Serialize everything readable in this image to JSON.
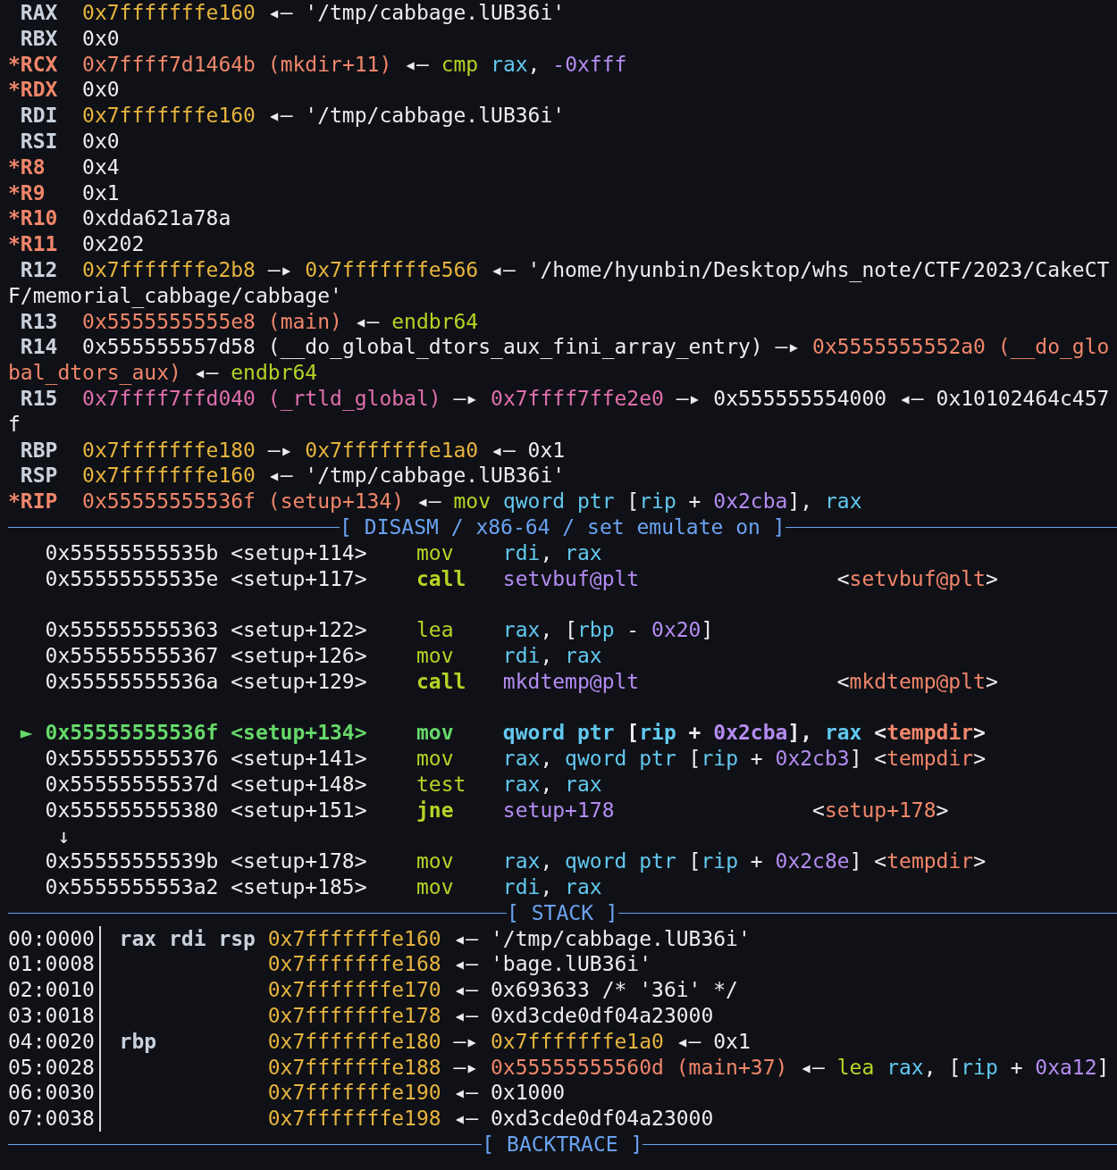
{
  "registers": [
    {
      "name": "RAX",
      "changed": false,
      "value": [
        {
          "text": "0x7fffffffe160",
          "kind": "stack"
        },
        {
          "text": "◂—",
          "kind": "arrow"
        },
        {
          "text": "'/tmp/cabbage.lUB36i'",
          "kind": "str"
        }
      ]
    },
    {
      "name": "RBX",
      "changed": false,
      "value": [
        {
          "text": "0x0",
          "kind": "plain"
        }
      ]
    },
    {
      "name": "*RCX",
      "changed": true,
      "value": [
        {
          "text": "0x7ffff7d1464b",
          "kind": "code"
        },
        {
          "text": "(mkdir+11)",
          "kind": "code"
        },
        {
          "text": "◂—",
          "kind": "arrow"
        },
        {
          "text": "cmp",
          "kind": "mnem"
        },
        {
          "text": "rax",
          "kind": "reg"
        },
        {
          "text": ",",
          "kind": "close"
        },
        {
          "text": "-0xfff",
          "kind": "num"
        }
      ]
    },
    {
      "name": "*RDX",
      "changed": true,
      "value": [
        {
          "text": "0x0",
          "kind": "plain"
        }
      ]
    },
    {
      "name": "RDI",
      "changed": false,
      "value": [
        {
          "text": "0x7fffffffe160",
          "kind": "stack"
        },
        {
          "text": "◂—",
          "kind": "arrow"
        },
        {
          "text": "'/tmp/cabbage.lUB36i'",
          "kind": "str"
        }
      ]
    },
    {
      "name": "RSI",
      "changed": false,
      "value": [
        {
          "text": "0x0",
          "kind": "plain"
        }
      ]
    },
    {
      "name": "*R8",
      "changed": true,
      "value": [
        {
          "text": "0x4",
          "kind": "plain"
        }
      ]
    },
    {
      "name": "*R9",
      "changed": true,
      "value": [
        {
          "text": "0x1",
          "kind": "plain"
        }
      ]
    },
    {
      "name": "*R10",
      "changed": true,
      "value": [
        {
          "text": "0xdda621a78a",
          "kind": "plain"
        }
      ]
    },
    {
      "name": "*R11",
      "changed": true,
      "value": [
        {
          "text": "0x202",
          "kind": "plain"
        }
      ]
    },
    {
      "name": "R12",
      "changed": false,
      "value": [
        {
          "text": "0x7fffffffe2b8",
          "kind": "stack"
        },
        {
          "text": "—▸",
          "kind": "arrow"
        },
        {
          "text": "0x7fffffffe566",
          "kind": "stack"
        },
        {
          "text": "◂—",
          "kind": "arrow"
        },
        {
          "text": "'/home/hyunbin/Desktop/whs_note/CTF/2023/CakeCT",
          "kind": "str"
        }
      ],
      "wrap": [
        {
          "text": "F/memorial_cabbage/cabbage'",
          "kind": "str"
        }
      ]
    },
    {
      "name": "R13",
      "changed": false,
      "value": [
        {
          "text": "0x5555555555e8",
          "kind": "code"
        },
        {
          "text": "(main)",
          "kind": "code"
        },
        {
          "text": "◂—",
          "kind": "arrow"
        },
        {
          "text": "endbr64",
          "kind": "mnem"
        }
      ]
    },
    {
      "name": "R14",
      "changed": false,
      "value": [
        {
          "text": "0x555555557d58",
          "kind": "plain"
        },
        {
          "text": "(__do_global_dtors_aux_fini_array_entry)",
          "kind": "plain"
        },
        {
          "text": "—▸",
          "kind": "arrow"
        },
        {
          "text": "0x5555555552a0",
          "kind": "code"
        },
        {
          "text": "(__do_glo",
          "kind": "code"
        }
      ],
      "wrap": [
        {
          "text": "bal_dtors_aux)",
          "kind": "code"
        },
        {
          "text": "◂—",
          "kind": "arrow"
        },
        {
          "text": "endbr64",
          "kind": "mnem"
        }
      ]
    },
    {
      "name": "R15",
      "changed": false,
      "value": [
        {
          "text": "0x7ffff7ffd040",
          "kind": "data"
        },
        {
          "text": "(_rtld_global)",
          "kind": "data"
        },
        {
          "text": "—▸",
          "kind": "arrow"
        },
        {
          "text": "0x7ffff7ffe2e0",
          "kind": "data"
        },
        {
          "text": "—▸",
          "kind": "arrow"
        },
        {
          "text": "0x555555554000",
          "kind": "plain"
        },
        {
          "text": "◂—",
          "kind": "arrow"
        },
        {
          "text": "0x10102464c457",
          "kind": "plain"
        }
      ],
      "wrap": [
        {
          "text": "f",
          "kind": "plain"
        }
      ]
    },
    {
      "name": "RBP",
      "changed": false,
      "value": [
        {
          "text": "0x7fffffffe180",
          "kind": "stack"
        },
        {
          "text": "—▸",
          "kind": "arrow"
        },
        {
          "text": "0x7fffffffe1a0",
          "kind": "stack"
        },
        {
          "text": "◂—",
          "kind": "arrow"
        },
        {
          "text": "0x1",
          "kind": "plain"
        }
      ]
    },
    {
      "name": "RSP",
      "changed": false,
      "value": [
        {
          "text": "0x7fffffffe160",
          "kind": "stack"
        },
        {
          "text": "◂—",
          "kind": "arrow"
        },
        {
          "text": "'/tmp/cabbage.lUB36i'",
          "kind": "str"
        }
      ]
    },
    {
      "name": "*RIP",
      "changed": true,
      "value": [
        {
          "text": "0x55555555536f",
          "kind": "code"
        },
        {
          "text": "(setup+134)",
          "kind": "code"
        },
        {
          "text": "◂—",
          "kind": "arrow"
        },
        {
          "text": "mov",
          "kind": "mnem"
        },
        {
          "text": "qword ptr",
          "kind": "reg"
        },
        {
          "text": "[",
          "kind": "open"
        },
        {
          "text": "rip",
          "kind": "reg"
        },
        {
          "text": "+",
          "kind": "plain"
        },
        {
          "text": "0x2cba",
          "kind": "num"
        },
        {
          "text": "],",
          "kind": "close"
        },
        {
          "text": "rax",
          "kind": "reg"
        }
      ]
    }
  ],
  "disasm": {
    "banner": "[ DISASM / x86-64 / set emulate on ]",
    "rows": [
      {
        "kind": "insn",
        "current": false,
        "addr": "0x55555555535b",
        "sym": "<setup+114>",
        "mnemonic": "mov",
        "operands": [
          {
            "text": "rdi",
            "kind": "reg"
          },
          {
            "text": ",",
            "kind": "close"
          },
          {
            "text": "rax",
            "kind": "reg"
          }
        ]
      },
      {
        "kind": "call",
        "current": false,
        "addr": "0x55555555535e",
        "sym": "<setup+117>",
        "mnemonic": "call",
        "operands": [
          {
            "text": "setvbuf@plt",
            "kind": "target"
          }
        ],
        "comment": [
          {
            "text": "<",
            "kind": "open"
          },
          {
            "text": "setvbuf@plt",
            "kind": "code"
          },
          {
            "text": ">",
            "kind": "close"
          }
        ]
      },
      {
        "kind": "blank"
      },
      {
        "kind": "insn",
        "current": false,
        "addr": "0x555555555363",
        "sym": "<setup+122>",
        "mnemonic": "lea",
        "operands": [
          {
            "text": "rax",
            "kind": "reg"
          },
          {
            "text": ",",
            "kind": "close"
          },
          {
            "text": "[",
            "kind": "open"
          },
          {
            "text": "rbp",
            "kind": "reg"
          },
          {
            "text": "-",
            "kind": "plain"
          },
          {
            "text": "0x20",
            "kind": "num"
          },
          {
            "text": "]",
            "kind": "close"
          }
        ]
      },
      {
        "kind": "insn",
        "current": false,
        "addr": "0x555555555367",
        "sym": "<setup+126>",
        "mnemonic": "mov",
        "operands": [
          {
            "text": "rdi",
            "kind": "reg"
          },
          {
            "text": ",",
            "kind": "close"
          },
          {
            "text": "rax",
            "kind": "reg"
          }
        ]
      },
      {
        "kind": "call",
        "current": false,
        "addr": "0x55555555536a",
        "sym": "<setup+129>",
        "mnemonic": "call",
        "operands": [
          {
            "text": "mkdtemp@plt",
            "kind": "target"
          }
        ],
        "comment": [
          {
            "text": "<",
            "kind": "open"
          },
          {
            "text": "mkdtemp@plt",
            "kind": "code"
          },
          {
            "text": ">",
            "kind": "close"
          }
        ]
      },
      {
        "kind": "blank"
      },
      {
        "kind": "insn",
        "current": true,
        "marker": "►",
        "addr": "0x55555555536f",
        "sym": "<setup+134>",
        "mnemonic": "mov",
        "operands": [
          {
            "text": "qword ptr",
            "kind": "reg"
          },
          {
            "text": "[",
            "kind": "open"
          },
          {
            "text": "rip",
            "kind": "reg"
          },
          {
            "text": "+",
            "kind": "plain"
          },
          {
            "text": "0x2cba",
            "kind": "num"
          },
          {
            "text": "],",
            "kind": "close"
          },
          {
            "text": "rax",
            "kind": "reg"
          }
        ],
        "comment": [
          {
            "text": "<",
            "kind": "open"
          },
          {
            "text": "tempdir",
            "kind": "code"
          },
          {
            "text": ">",
            "kind": "close"
          }
        ]
      },
      {
        "kind": "insn",
        "current": false,
        "addr": "0x555555555376",
        "sym": "<setup+141>",
        "mnemonic": "mov",
        "operands": [
          {
            "text": "rax",
            "kind": "reg"
          },
          {
            "text": ",",
            "kind": "close"
          },
          {
            "text": "qword ptr",
            "kind": "reg"
          },
          {
            "text": "[",
            "kind": "open"
          },
          {
            "text": "rip",
            "kind": "reg"
          },
          {
            "text": "+",
            "kind": "plain"
          },
          {
            "text": "0x2cb3",
            "kind": "num"
          },
          {
            "text": "]",
            "kind": "close"
          }
        ],
        "comment": [
          {
            "text": "<",
            "kind": "open"
          },
          {
            "text": "tempdir",
            "kind": "code"
          },
          {
            "text": ">",
            "kind": "close"
          }
        ]
      },
      {
        "kind": "insn",
        "current": false,
        "addr": "0x55555555537d",
        "sym": "<setup+148>",
        "mnemonic": "test",
        "operands": [
          {
            "text": "rax",
            "kind": "reg"
          },
          {
            "text": ",",
            "kind": "close"
          },
          {
            "text": "rax",
            "kind": "reg"
          }
        ]
      },
      {
        "kind": "jump",
        "current": false,
        "addr": "0x555555555380",
        "sym": "<setup+151>",
        "mnemonic": "jne",
        "operands": [
          {
            "text": "setup+178",
            "kind": "target"
          }
        ],
        "comment": [
          {
            "text": "<",
            "kind": "open"
          },
          {
            "text": "setup+178",
            "kind": "code"
          },
          {
            "text": ">",
            "kind": "close"
          }
        ]
      },
      {
        "kind": "flow",
        "text": "↓"
      },
      {
        "kind": "insn",
        "current": false,
        "addr": "0x55555555539b",
        "sym": "<setup+178>",
        "mnemonic": "mov",
        "operands": [
          {
            "text": "rax",
            "kind": "reg"
          },
          {
            "text": ",",
            "kind": "close"
          },
          {
            "text": "qword ptr",
            "kind": "reg"
          },
          {
            "text": "[",
            "kind": "open"
          },
          {
            "text": "rip",
            "kind": "reg"
          },
          {
            "text": "+",
            "kind": "plain"
          },
          {
            "text": "0x2c8e",
            "kind": "num"
          },
          {
            "text": "]",
            "kind": "close"
          }
        ],
        "comment": [
          {
            "text": "<",
            "kind": "open"
          },
          {
            "text": "tempdir",
            "kind": "code"
          },
          {
            "text": ">",
            "kind": "close"
          }
        ]
      },
      {
        "kind": "insn",
        "current": false,
        "addr": "0x5555555553a2",
        "sym": "<setup+185>",
        "mnemonic": "mov",
        "operands": [
          {
            "text": "rdi",
            "kind": "reg"
          },
          {
            "text": ",",
            "kind": "close"
          },
          {
            "text": "rax",
            "kind": "reg"
          }
        ]
      }
    ]
  },
  "stack": {
    "banner": "[ STACK ]",
    "rows": [
      {
        "offset": "00:0000",
        "regs": "rax rdi rsp",
        "addr": "0x7fffffffe160",
        "chain": [
          {
            "text": "◂—",
            "kind": "arrow"
          },
          {
            "text": "'/tmp/cabbage.lUB36i'",
            "kind": "str"
          }
        ]
      },
      {
        "offset": "01:0008",
        "addr": "0x7fffffffe168",
        "chain": [
          {
            "text": "◂—",
            "kind": "arrow"
          },
          {
            "text": "'bage.lUB36i'",
            "kind": "str"
          }
        ]
      },
      {
        "offset": "02:0010",
        "addr": "0x7fffffffe170",
        "chain": [
          {
            "text": "◂—",
            "kind": "arrow"
          },
          {
            "text": "0x693633 /* '36i' */",
            "kind": "plain"
          }
        ]
      },
      {
        "offset": "03:0018",
        "addr": "0x7fffffffe178",
        "chain": [
          {
            "text": "◂—",
            "kind": "arrow"
          },
          {
            "text": "0xd3cde0df04a23000",
            "kind": "plain"
          }
        ]
      },
      {
        "offset": "04:0020",
        "regs": "rbp",
        "addr": "0x7fffffffe180",
        "chain": [
          {
            "text": "—▸",
            "kind": "arrow"
          },
          {
            "text": "0x7fffffffe1a0",
            "kind": "stack"
          },
          {
            "text": "◂—",
            "kind": "arrow"
          },
          {
            "text": "0x1",
            "kind": "plain"
          }
        ]
      },
      {
        "offset": "05:0028",
        "addr": "0x7fffffffe188",
        "chain": [
          {
            "text": "—▸",
            "kind": "arrow"
          },
          {
            "text": "0x55555555560d",
            "kind": "code"
          },
          {
            "text": "(main+37)",
            "kind": "code"
          },
          {
            "text": "◂—",
            "kind": "arrow"
          },
          {
            "text": "lea",
            "kind": "mnem"
          },
          {
            "text": "rax",
            "kind": "reg"
          },
          {
            "text": ",",
            "kind": "close"
          },
          {
            "text": "[",
            "kind": "open"
          },
          {
            "text": "rip",
            "kind": "reg"
          },
          {
            "text": "+",
            "kind": "plain"
          },
          {
            "text": "0xa12",
            "kind": "num"
          },
          {
            "text": "]",
            "kind": "close"
          }
        ]
      },
      {
        "offset": "06:0030",
        "addr": "0x7fffffffe190",
        "chain": [
          {
            "text": "◂—",
            "kind": "arrow"
          },
          {
            "text": "0x1000",
            "kind": "plain"
          }
        ]
      },
      {
        "offset": "07:0038",
        "addr": "0x7fffffffe198",
        "chain": [
          {
            "text": "◂—",
            "kind": "arrow"
          },
          {
            "text": "0xd3cde0df04a23000",
            "kind": "plain"
          }
        ]
      }
    ]
  },
  "backtrace": {
    "banner": "[ BACKTRACE ]"
  }
}
